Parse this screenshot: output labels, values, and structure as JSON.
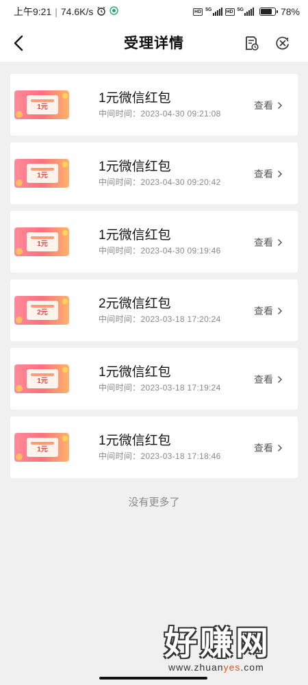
{
  "status_bar": {
    "time": "上午9:21",
    "speed": "74.6K/s",
    "network_badges": [
      "HD",
      "5G",
      "HD",
      "5G"
    ],
    "battery_percent": "78%",
    "battery_level": 0.78
  },
  "header": {
    "title": "受理详情"
  },
  "records": [
    {
      "thumb_amount": "1元",
      "title": "1元微信红包",
      "time": "中间时间：2023-04-30 09:21:08",
      "action": "查看"
    },
    {
      "thumb_amount": "1元",
      "title": "1元微信红包",
      "time": "中间时间：2023-04-30 09:20:42",
      "action": "查看"
    },
    {
      "thumb_amount": "1元",
      "title": "1元微信红包",
      "time": "中间时间：2023-04-30 09:19:46",
      "action": "查看"
    },
    {
      "thumb_amount": "2元",
      "title": "2元微信红包",
      "time": "中间时间：2023-03-18 17:20:24",
      "action": "查看"
    },
    {
      "thumb_amount": "1元",
      "title": "1元微信红包",
      "time": "中间时间：2023-03-18 17:19:24",
      "action": "查看"
    },
    {
      "thumb_amount": "1元",
      "title": "1元微信红包",
      "time": "中间时间：2023-03-18 17:18:46",
      "action": "查看"
    }
  ],
  "footer": {
    "no_more": "没有更多了"
  },
  "watermark": {
    "title": "好赚网",
    "url_prefix": "www.zhuan",
    "url_accent": "yes",
    "url_suffix": ".com"
  },
  "colors": {
    "accent_red": "#e8434b",
    "watermark_accent": "#e8551d"
  }
}
